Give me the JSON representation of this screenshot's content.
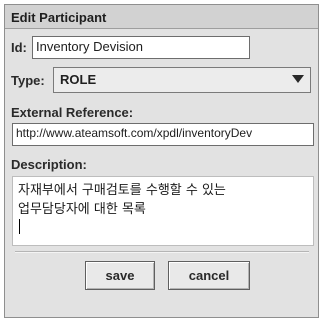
{
  "dialog": {
    "title": "Edit Participant"
  },
  "fields": {
    "id": {
      "label": "Id:",
      "value": "Inventory Devision"
    },
    "type": {
      "label": "Type:",
      "value": "ROLE",
      "icon": "chevron-down-icon"
    },
    "external_reference": {
      "label": "External Reference:",
      "value": "http://www.ateamsoft.com/xpdl/inventoryDev"
    },
    "description": {
      "label": "Description:",
      "lines": [
        "자재부에서 구매검토를 수행할 수 있는",
        "업무담당자에 대한 목록"
      ]
    }
  },
  "buttons": {
    "save": "save",
    "cancel": "cancel"
  }
}
